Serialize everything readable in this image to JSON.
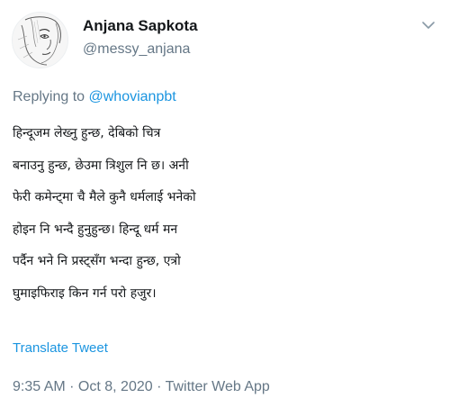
{
  "author": {
    "name": "Anjana Sapkota",
    "handle": "@messy_anjana"
  },
  "reply": {
    "prefix": "Replying to ",
    "mention": "@whovianpbt"
  },
  "tweet": {
    "lines": [
      "हिन्दूजम लेख्नु हुन्छ, देबिको चित्र",
      "बनाउनु हुन्छ, छेउमा त्रिशुल नि छ। अनी",
      "फेरी कमेन्ट्मा चै मैले कुनै धर्मलाई भनेको",
      "होइन नि भन्दै हुनुहुन्छ। हिन्दू धर्म मन",
      "पर्दैन भने नि प्रस्ट्सँग भन्दा हुन्छ, एत्रो",
      "घुमाइफिराइ किन गर्न परो हजुर।"
    ]
  },
  "translate_label": "Translate Tweet",
  "meta": {
    "time": "9:35 AM",
    "separator": " · ",
    "date": "Oct 8, 2020",
    "source": "Twitter Web App"
  },
  "icons": {
    "menu": "chevron-down-icon"
  },
  "colors": {
    "text": "#14171a",
    "secondary": "#657786",
    "link": "#1b95e0"
  }
}
